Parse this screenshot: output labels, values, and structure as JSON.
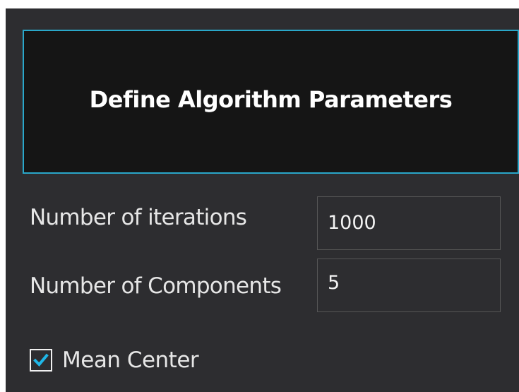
{
  "header": {
    "title": "Define Algorithm Parameters"
  },
  "fields": {
    "iterations": {
      "label": "Number of iterations",
      "value": "1000"
    },
    "components": {
      "label": "Number of Components",
      "value": "5"
    }
  },
  "options": {
    "mean_center": {
      "label": "Mean Center",
      "checked": true
    }
  },
  "colors": {
    "background": "#2d2d30",
    "header_background": "#151515",
    "accent": "#2aa7c9",
    "check": "#1fb7e8"
  },
  "icons": {
    "checkbox_mark": "checkmark-icon"
  }
}
